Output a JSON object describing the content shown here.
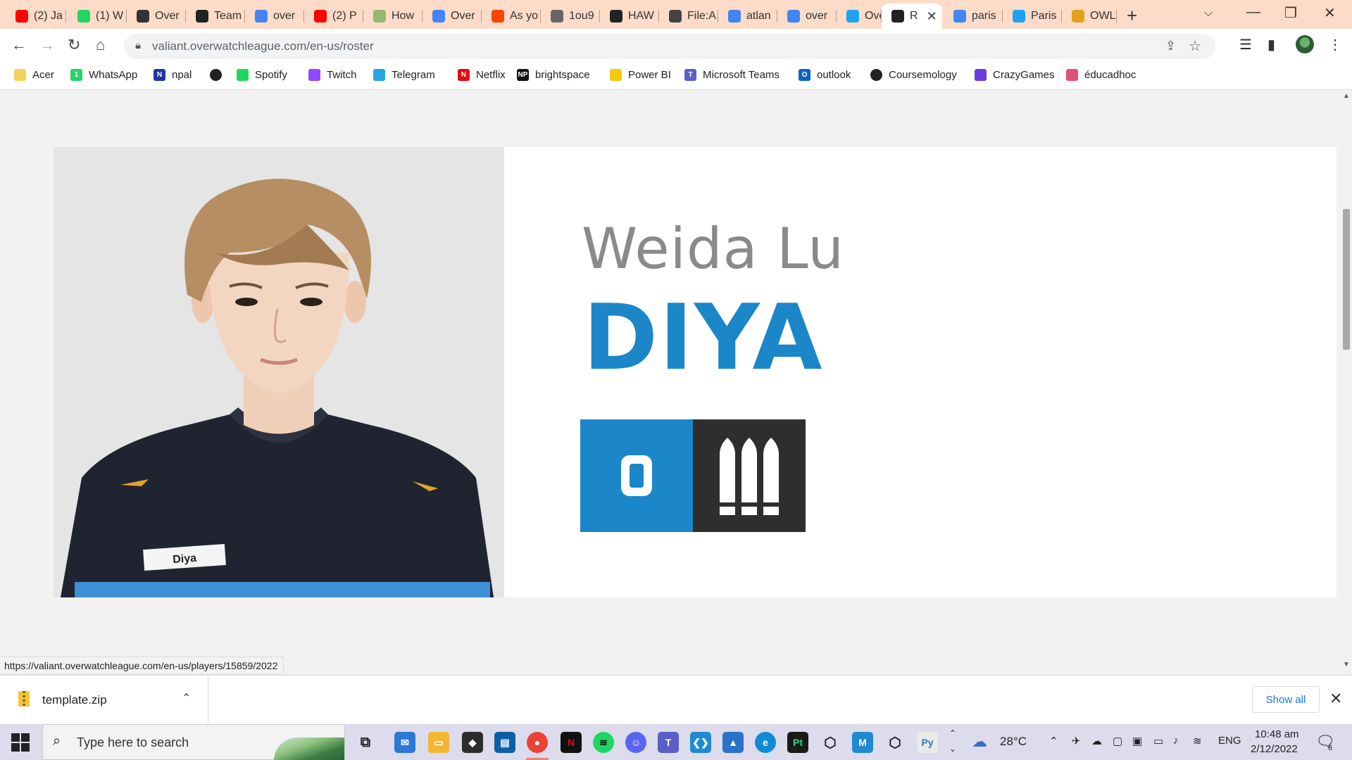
{
  "tabs": [
    {
      "label": "(2) Ja",
      "icon": "youtube-icon",
      "color": "#ff0000"
    },
    {
      "label": "(1) W",
      "icon": "whatsapp-icon",
      "color": "#25d366"
    },
    {
      "label": "Over",
      "icon": "overwatch-icon",
      "color": "#333333"
    },
    {
      "label": "Team",
      "icon": "valiant-icon",
      "color": "#222222"
    },
    {
      "label": "over",
      "icon": "google-icon",
      "color": "#4285f4"
    },
    {
      "label": "(2) P",
      "icon": "youtube-icon",
      "color": "#ff0000"
    },
    {
      "label": "How",
      "icon": "wikihow-icon",
      "color": "#93b874"
    },
    {
      "label": "Over",
      "icon": "google-icon",
      "color": "#4285f4"
    },
    {
      "label": "As yo",
      "icon": "reddit-icon",
      "color": "#ff4500"
    },
    {
      "label": "1ou9",
      "icon": "globe-icon",
      "color": "#666666"
    },
    {
      "label": "HAW",
      "icon": "valiant-icon",
      "color": "#222222"
    },
    {
      "label": "File:A",
      "icon": "wiki-icon",
      "color": "#444444"
    },
    {
      "label": "atlan",
      "icon": "google-icon",
      "color": "#4285f4"
    },
    {
      "label": "over",
      "icon": "google-icon",
      "color": "#4285f4"
    },
    {
      "label": "Over",
      "icon": "twitter-icon",
      "color": "#1da1f2"
    },
    {
      "label": "R",
      "icon": "valiant-icon",
      "color": "#222222",
      "active": true
    },
    {
      "label": "paris",
      "icon": "google-icon",
      "color": "#4285f4"
    },
    {
      "label": "Paris",
      "icon": "twitter-icon",
      "color": "#1da1f2"
    },
    {
      "label": "OWL",
      "icon": "owl-icon",
      "color": "#e0a21a"
    }
  ],
  "toolbar": {
    "url": "valiant.overwatchleague.com/en-us/roster"
  },
  "bookmarks": [
    {
      "label": "Acer",
      "icon": "folder-icon",
      "color": "#f5d15a",
      "glyph": ""
    },
    {
      "label": "WhatsApp",
      "icon": "whatsapp-icon",
      "color": "#25d366",
      "glyph": "1"
    },
    {
      "label": "npal",
      "icon": "npal-icon",
      "color": "#2233aa",
      "glyph": "N"
    },
    {
      "label": "",
      "icon": "globe-icon",
      "color": "#222222",
      "glyph": ""
    },
    {
      "label": "Spotify",
      "icon": "spotify-icon",
      "color": "#1ed760",
      "glyph": ""
    },
    {
      "label": "Twitch",
      "icon": "twitch-icon",
      "color": "#9146ff",
      "glyph": ""
    },
    {
      "label": "Telegram",
      "icon": "telegram-icon",
      "color": "#2aa3de",
      "glyph": ""
    },
    {
      "label": "Netflix",
      "icon": "netflix-icon",
      "color": "#e50914",
      "glyph": "N"
    },
    {
      "label": "brightspace",
      "icon": "np-icon",
      "color": "#111111",
      "glyph": "NP"
    },
    {
      "label": "Power BI",
      "icon": "powerbi-icon",
      "color": "#f2c811",
      "glyph": ""
    },
    {
      "label": "Microsoft Teams",
      "icon": "teams-icon",
      "color": "#5b5fc7",
      "glyph": "T"
    },
    {
      "label": "outlook",
      "icon": "outlook-icon",
      "color": "#0a64c8",
      "glyph": "O"
    },
    {
      "label": "Coursemology",
      "icon": "coursemology-icon",
      "color": "#222222",
      "glyph": ""
    },
    {
      "label": "CrazyGames",
      "icon": "crazygames-icon",
      "color": "#6c3ce0",
      "glyph": ""
    },
    {
      "label": "éducadhoc",
      "icon": "educadhoc-icon",
      "color": "#e0507a",
      "glyph": ""
    }
  ],
  "player": {
    "real_name": "Weida Lu",
    "handle": "DIYA",
    "jersey_name": "Diya",
    "role": "damage",
    "colors": {
      "accent": "#1b86c8",
      "dark_tile": "#2e2e2e",
      "photo_bg": "#e5e5e5"
    }
  },
  "status_url": "https://valiant.overwatchleague.com/en-us/players/15859/2022",
  "download": {
    "filename": "template.zip",
    "show_all": "Show all"
  },
  "taskbar": {
    "search_placeholder": "Type here to search",
    "temperature": "28°C",
    "language": "ENG",
    "time": "10:48 am",
    "date": "2/12/2022",
    "notification_count": "6"
  }
}
